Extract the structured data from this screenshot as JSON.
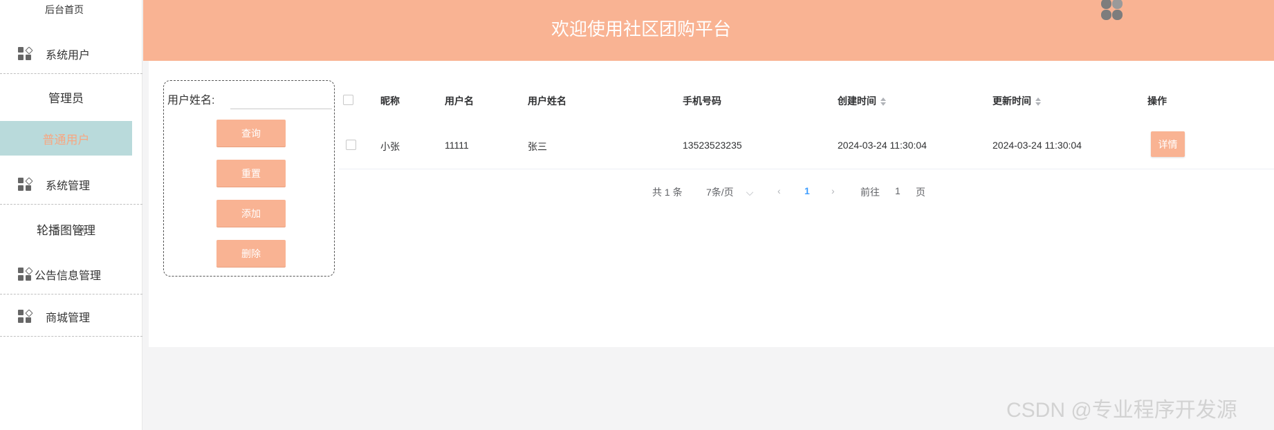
{
  "sidebar": {
    "home": "后台首页",
    "groups": [
      {
        "label": "系统用户"
      },
      {
        "label": "系统管理"
      },
      {
        "label": "公告信息管理"
      },
      {
        "label": "商城管理"
      }
    ],
    "sub_items": [
      "管理员",
      "普通用户",
      "轮播图管理"
    ],
    "active_item": "普通用户"
  },
  "header": {
    "title": "欢迎使用社区团购平台"
  },
  "search": {
    "label": "用户姓名:",
    "input_value": "",
    "buttons": {
      "query": "查询",
      "reset": "重置",
      "add": "添加",
      "delete": "删除"
    }
  },
  "table": {
    "columns": [
      "昵称",
      "用户名",
      "用户姓名",
      "手机号码",
      "创建时间",
      "更新时间",
      "操作"
    ],
    "rows": [
      {
        "nickname": "小张",
        "username": "11111",
        "realname": "张三",
        "phone": "13523523235",
        "created": "2024-03-24 11:30:04",
        "updated": "2024-03-24 11:30:04",
        "action": "详情"
      }
    ]
  },
  "pagination": {
    "total": "共 1 条",
    "page_size": "7条/页",
    "current_page": "1",
    "goto_prefix": "前往",
    "goto_value": "1",
    "goto_suffix": "页"
  },
  "watermark": "CSDN @专业程序开发源",
  "colors": {
    "accent": "#f9b393",
    "active_bg": "#b9dadb",
    "active_text": "#f7a782",
    "pager_active": "#409eff"
  }
}
